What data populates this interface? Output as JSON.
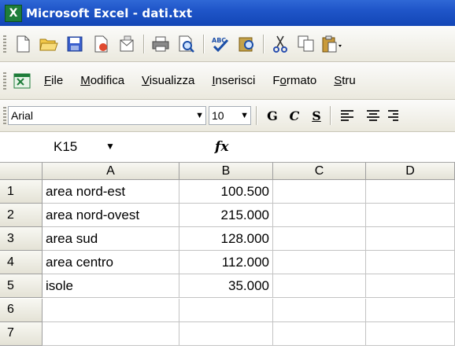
{
  "window": {
    "title": "Microsoft Excel - dati.txt",
    "app_icon_glyph": "X"
  },
  "standard_toolbar": {
    "icons": [
      "new-icon",
      "open-icon",
      "save-icon",
      "permission-icon",
      "email-icon",
      "print-icon",
      "print-preview-icon",
      "spelling-icon",
      "research-icon",
      "cut-icon",
      "copy-icon",
      "paste-icon"
    ]
  },
  "menu": {
    "items": [
      {
        "pre": "",
        "u": "F",
        "post": "ile"
      },
      {
        "pre": "",
        "u": "M",
        "post": "odifica"
      },
      {
        "pre": "",
        "u": "V",
        "post": "isualizza"
      },
      {
        "pre": "",
        "u": "I",
        "post": "nserisci"
      },
      {
        "pre": "F",
        "u": "o",
        "post": "rmato"
      },
      {
        "pre": "",
        "u": "S",
        "post": "tru"
      }
    ]
  },
  "formatting": {
    "font_name": "Arial",
    "font_size": "10",
    "bold": "G",
    "italic": "C",
    "underline": "S"
  },
  "formula_bar": {
    "name_box": "K15",
    "fx": "fx",
    "content": ""
  },
  "sheet": {
    "columns": [
      "A",
      "B",
      "C",
      "D"
    ],
    "rows": [
      {
        "n": "1",
        "a": "area nord-est",
        "b": "100.500",
        "c": "",
        "d": ""
      },
      {
        "n": "2",
        "a": "area nord-ovest",
        "b": "215.000",
        "c": "",
        "d": ""
      },
      {
        "n": "3",
        "a": "area sud",
        "b": "128.000",
        "c": "",
        "d": ""
      },
      {
        "n": "4",
        "a": "area centro",
        "b": "112.000",
        "c": "",
        "d": ""
      },
      {
        "n": "5",
        "a": "isole",
        "b": "35.000",
        "c": "",
        "d": ""
      },
      {
        "n": "6",
        "a": "",
        "b": "",
        "c": "",
        "d": ""
      },
      {
        "n": "7",
        "a": "",
        "b": "",
        "c": "",
        "d": ""
      }
    ]
  }
}
